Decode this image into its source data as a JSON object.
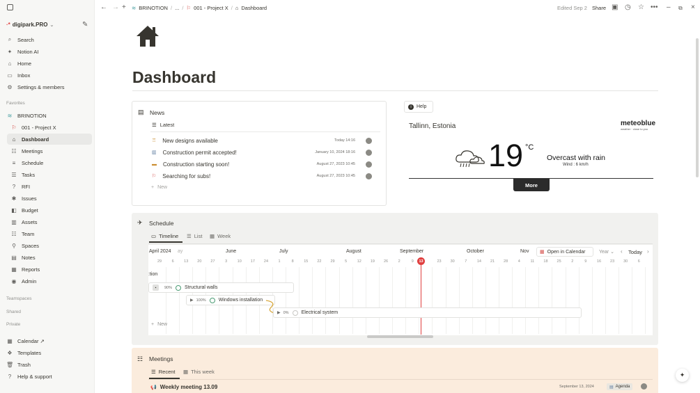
{
  "sidebar": {
    "workspace": "digipark.PRO",
    "top_items": [
      {
        "icon": "search-icon",
        "label": "Search"
      },
      {
        "icon": "notion-ai-icon",
        "label": "Notion AI"
      },
      {
        "icon": "home-icon",
        "label": "Home"
      },
      {
        "icon": "inbox-icon",
        "label": "Inbox"
      },
      {
        "icon": "settings-icon",
        "label": "Settings & members"
      }
    ],
    "favorites_label": "Favorites",
    "favorites": [
      {
        "icon": "brinotion-icon",
        "label": "BRINOTION"
      },
      {
        "icon": "project-icon",
        "label": "001 - Project X"
      },
      {
        "icon": "house-icon",
        "label": "Dashboard"
      },
      {
        "icon": "people-icon",
        "label": "Meetings"
      },
      {
        "icon": "schedule-icon",
        "label": "Schedule"
      },
      {
        "icon": "tasks-icon",
        "label": "Tasks"
      },
      {
        "icon": "question-icon",
        "label": "RFI"
      },
      {
        "icon": "issues-icon",
        "label": "Issues"
      },
      {
        "icon": "budget-icon",
        "label": "Budget"
      },
      {
        "icon": "assets-icon",
        "label": "Assets"
      },
      {
        "icon": "team-icon",
        "label": "Team"
      },
      {
        "icon": "location-icon",
        "label": "Spaces"
      },
      {
        "icon": "notes-icon",
        "label": "Notes"
      },
      {
        "icon": "reports-icon",
        "label": "Reports"
      },
      {
        "icon": "admin-icon",
        "label": "Admin"
      }
    ],
    "teamspaces_label": "Teamspaces",
    "shared_label": "Shared",
    "private_label": "Private",
    "bottom_items": [
      {
        "icon": "calendar-icon",
        "label": "Calendar ↗"
      },
      {
        "icon": "templates-icon",
        "label": "Templates"
      },
      {
        "icon": "trash-icon",
        "label": "Trash"
      },
      {
        "icon": "help-icon",
        "label": "Help & support"
      }
    ]
  },
  "topbar": {
    "breadcrumb": [
      "BRINOTION",
      "...",
      "001 - Project X",
      "Dashboard"
    ],
    "edited": "Edited Sep 2",
    "share": "Share"
  },
  "page": {
    "title": "Dashboard"
  },
  "news": {
    "title": "News",
    "view": "Latest",
    "items": [
      {
        "title": "New designs available",
        "date": "Today 14:16"
      },
      {
        "title": "Construction permit accepted!",
        "date": "January 10, 2024 18:16"
      },
      {
        "title": "Construction starting soon!",
        "date": "August 27, 2023 10:45"
      },
      {
        "title": "Searching for subs!",
        "date": "August 27, 2023 10:45"
      }
    ],
    "new": "New"
  },
  "weather": {
    "help": "Help",
    "location": "Tallinn, Estonia",
    "brand": "meteoblue",
    "brand_sub": "weather · close to you",
    "temp": "19",
    "unit": "°C",
    "condition": "Overcast with rain",
    "wind": "Wind : 6 km/h",
    "more": "More"
  },
  "schedule": {
    "title": "Schedule",
    "views": [
      "Timeline",
      "List",
      "Week"
    ],
    "months": [
      "April 2024",
      "June",
      "July",
      "August",
      "September",
      "October",
      "Nov"
    ],
    "days": [
      "29",
      "6",
      "13",
      "20",
      "27",
      "3",
      "10",
      "17",
      "24",
      "1",
      "8",
      "15",
      "22",
      "29",
      "5",
      "12",
      "19",
      "26",
      "2",
      "9",
      "13",
      "23",
      "30",
      "7",
      "14",
      "21",
      "28",
      "4",
      "11",
      "18",
      "25",
      "2",
      "9",
      "16",
      "23",
      "30",
      "6"
    ],
    "today_day": "13",
    "open_calendar": "Open in Calendar",
    "zoom": "Year",
    "today": "Today",
    "tasks": [
      {
        "name": "Structural walls",
        "pct": "90%"
      },
      {
        "name": "Windows installation",
        "pct": "100%"
      },
      {
        "name": "Electrical system",
        "pct": "0%"
      }
    ],
    "new": "New"
  },
  "meetings": {
    "title": "Meetings",
    "views": [
      "Recent",
      "This week"
    ],
    "item": {
      "title": "Weekly meeting 13.09",
      "date": "September 13, 2024",
      "tag": "Agenda"
    }
  }
}
